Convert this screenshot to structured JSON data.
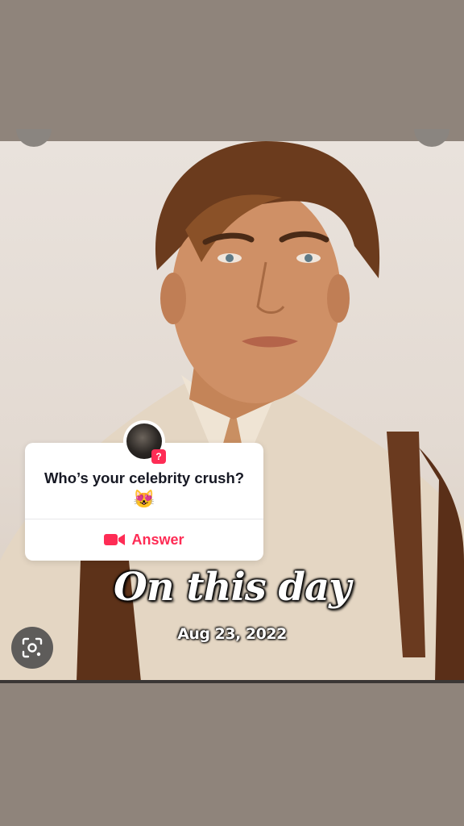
{
  "question_sticker": {
    "question_text": "Who’s your celebrity crush?",
    "emoji": "😻",
    "badge": "?",
    "answer_label": "Answer",
    "answer_icon": "video-camera-icon",
    "accent_color": "#fe2c55"
  },
  "overlay": {
    "title": "On this day",
    "date": "Aug 23, 2022"
  },
  "lens_button": {
    "icon": "lens-search-icon"
  },
  "colors": {
    "background": "#8f847b",
    "photo_bg": "#e6ddd5"
  }
}
